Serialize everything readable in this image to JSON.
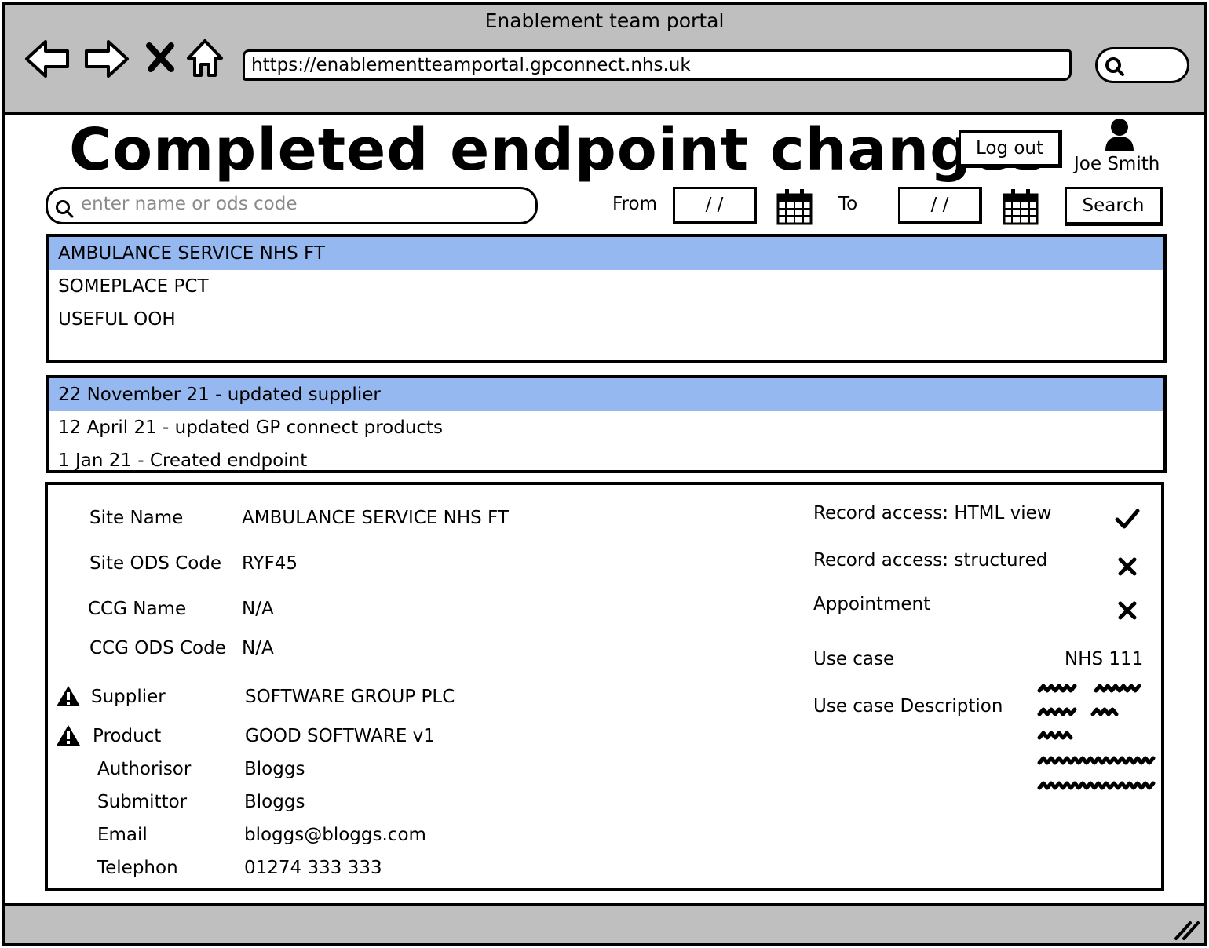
{
  "window": {
    "title": "Enablement team portal"
  },
  "browser": {
    "url": "https://enablementteamportal.gpconnect.nhs.uk",
    "icons": [
      "back-arrow-icon",
      "forward-arrow-icon",
      "close-icon",
      "home-icon",
      "search-icon"
    ]
  },
  "header": {
    "title": "Completed endpoint changes",
    "logout_label": "Log out",
    "user_name": "Joe Smith"
  },
  "search": {
    "placeholder": "enter name or ods code",
    "from_label": "From",
    "from_value": "/ /",
    "to_label": "To",
    "to_value": "/ /",
    "button_label": "Search"
  },
  "organisations": {
    "items": [
      {
        "label": "AMBULANCE SERVICE NHS FT",
        "selected": true
      },
      {
        "label": "SOMEPLACE PCT",
        "selected": false
      },
      {
        "label": "USEFUL OOH",
        "selected": false
      }
    ]
  },
  "history": {
    "items": [
      {
        "label": "22 November 21 - updated supplier",
        "selected": true
      },
      {
        "label": "12 April 21 - updated GP connect products",
        "selected": false
      },
      {
        "label": "1 Jan 21 - Created endpoint",
        "selected": false
      }
    ]
  },
  "details": {
    "fields": [
      {
        "label": "Site Name",
        "value": "AMBULANCE SERVICE NHS FT"
      },
      {
        "label": "Site ODS Code",
        "value": "RYF45"
      },
      {
        "label": "CCG Name",
        "value": "N/A"
      },
      {
        "label": "CCG ODS Code",
        "value": "N/A"
      },
      {
        "label": "Supplier",
        "value": "SOFTWARE GROUP PLC",
        "warning": true
      },
      {
        "label": "Product",
        "value": "GOOD SOFTWARE v1",
        "warning": true
      },
      {
        "label": "Authorisor",
        "value": "Bloggs"
      },
      {
        "label": "Submittor",
        "value": "Bloggs"
      },
      {
        "label": "Email",
        "value": "bloggs@bloggs.com"
      },
      {
        "label": "Telephon",
        "value": "01274 333 333"
      }
    ],
    "capabilities": [
      {
        "label": "Record access: HTML view",
        "enabled": true
      },
      {
        "label": "Record access: structured",
        "enabled": false
      },
      {
        "label": "Appointment",
        "enabled": false
      }
    ],
    "use_case_label": "Use case",
    "use_case_value": "NHS 111",
    "use_case_description_label": "Use case Description"
  },
  "colors": {
    "chrome": "#bfbfbf",
    "selection": "#94b8ef",
    "placeholder": "#8a8a8a"
  }
}
